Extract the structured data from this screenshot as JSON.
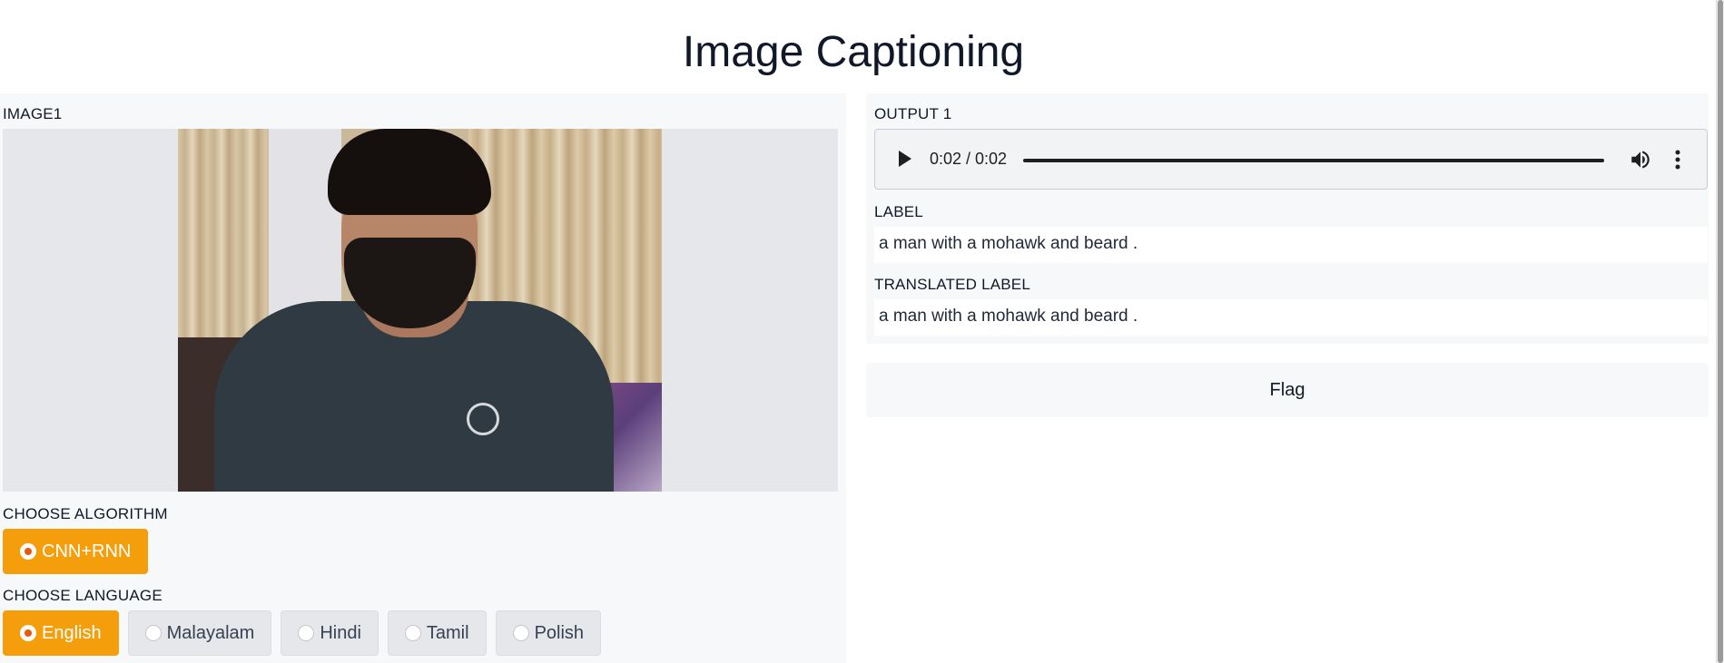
{
  "app": {
    "title": "Image Captioning"
  },
  "inputs": {
    "image_label": "IMAGE1",
    "algorithm": {
      "label": "CHOOSE ALGORITHM",
      "options": [
        "CNN+RNN"
      ],
      "selected": "CNN+RNN"
    },
    "language": {
      "label": "CHOOSE LANGUAGE",
      "options": [
        "English",
        "Malayalam",
        "Hindi",
        "Tamil",
        "Polish"
      ],
      "selected": "English"
    }
  },
  "outputs": {
    "audio": {
      "label": "OUTPUT 1",
      "time": "0:02 / 0:02",
      "icons": [
        "play-icon",
        "volume-icon",
        "more-options-icon"
      ]
    },
    "caption": {
      "label": "LABEL",
      "value": "a man with a mohawk and beard ."
    },
    "translated": {
      "label": "TRANSLATED LABEL",
      "value": "a man with a mohawk and beard ."
    }
  },
  "actions": {
    "flag_label": "Flag"
  },
  "colors": {
    "accent": "#f59e0b",
    "panel": "#f7f8fa"
  }
}
